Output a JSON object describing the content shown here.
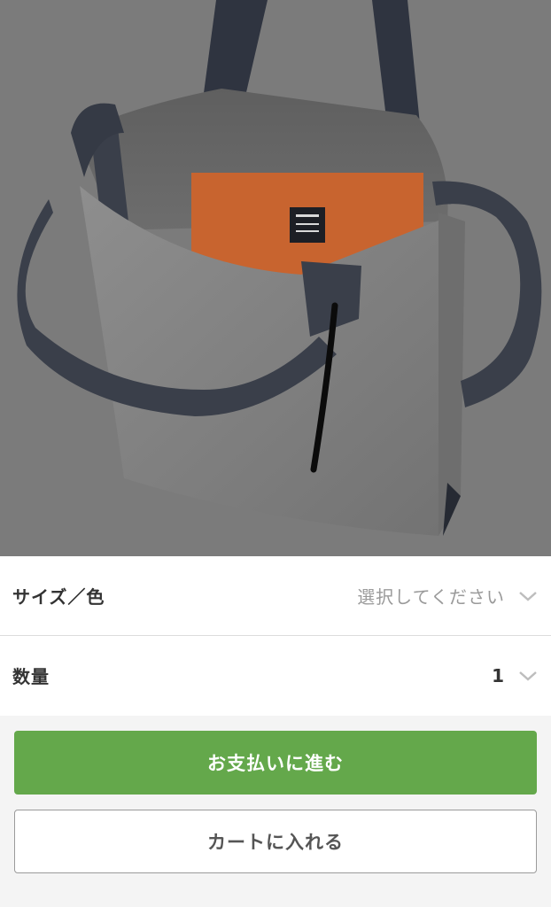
{
  "product": {
    "image_alt": "tote-bag-photo"
  },
  "options": {
    "size_color": {
      "label": "サイズ／色",
      "value": "選択してください",
      "icon": "chevron-down-icon"
    },
    "quantity": {
      "label": "数量",
      "value": "1",
      "icon": "chevron-down-icon"
    }
  },
  "actions": {
    "checkout_label": "お支払いに進む",
    "add_to_cart_label": "カートに入れる"
  },
  "colors": {
    "primary": "#64a84b",
    "chevron": "#bdbdbd"
  }
}
